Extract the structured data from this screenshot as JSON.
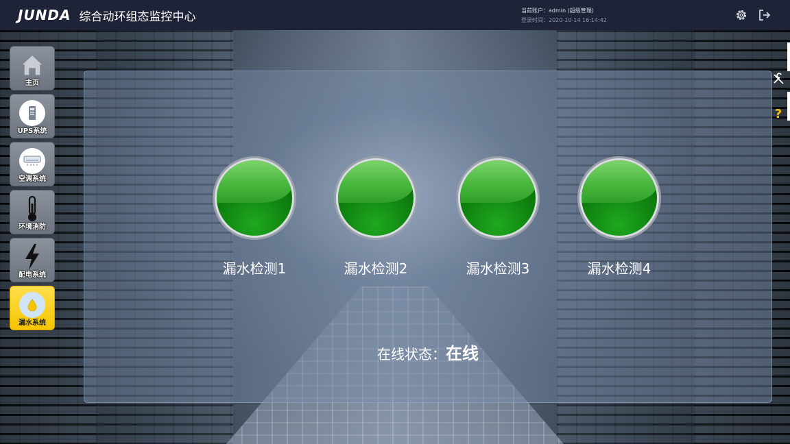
{
  "header": {
    "logo": "JUNDA",
    "title": "综合动环组态监控中心",
    "account_text": "当前账户：admin (超级管理)",
    "login_text": "登录时间：2020-10-14 16:14:42"
  },
  "sidebar": {
    "items": [
      {
        "label": "主页",
        "icon": "home-icon",
        "active": false
      },
      {
        "label": "UPS系统",
        "icon": "ups-icon",
        "active": false
      },
      {
        "label": "空调系统",
        "icon": "air-conditioner-icon",
        "active": false
      },
      {
        "label": "环境消防",
        "icon": "thermometer-icon",
        "active": false
      },
      {
        "label": "配电系统",
        "icon": "lightning-icon",
        "active": false
      },
      {
        "label": "漏水系统",
        "icon": "water-drop-icon",
        "active": true
      }
    ]
  },
  "main": {
    "sensors": [
      {
        "label": "漏水检测1",
        "state_color": "#1aa51a"
      },
      {
        "label": "漏水检测2",
        "state_color": "#1aa51a"
      },
      {
        "label": "漏水检测3",
        "state_color": "#1aa51a"
      },
      {
        "label": "漏水检测4",
        "state_color": "#1aa51a"
      }
    ],
    "status_label": "在线状态：",
    "status_value": "在线"
  },
  "right_tools": {
    "help_symbol": "?"
  },
  "colors": {
    "header_bg": "#1f2337",
    "active_nav": "#f5c400",
    "lamp_green": "#1aa51a"
  }
}
